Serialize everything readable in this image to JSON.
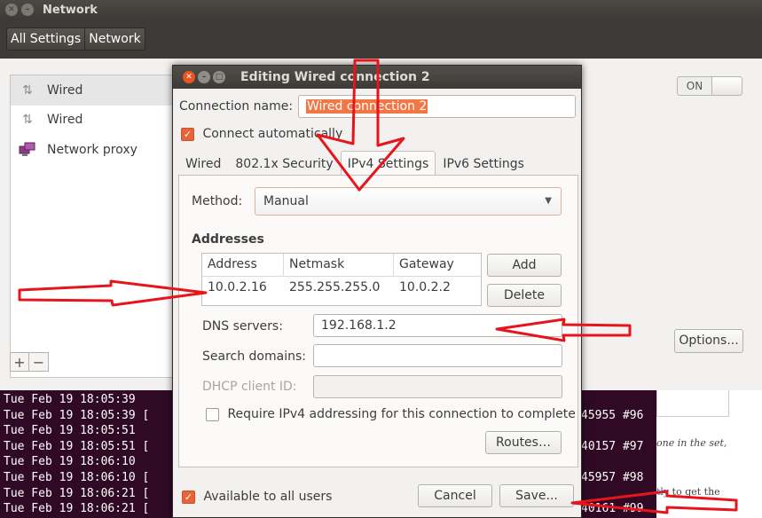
{
  "network_window": {
    "title": "Network",
    "toolbar": {
      "all_settings": "All Settings",
      "network": "Network"
    },
    "sidebar": [
      {
        "label": "Wired",
        "icon": "wired-icon"
      },
      {
        "label": "Wired",
        "icon": "wired-icon"
      },
      {
        "label": "Network proxy",
        "icon": "network-proxy-icon"
      }
    ],
    "switch_label": "ON",
    "add_symbol": "+",
    "remove_symbol": "−",
    "options_label": "Options..."
  },
  "dialog": {
    "title": "Editing Wired connection 2",
    "connection_name_label": "Connection name:",
    "connection_name_value": "Wired connection 2",
    "connect_auto_label": "Connect automatically",
    "connect_auto_checked": true,
    "tabs": [
      "Wired",
      "802.1x Security",
      "IPv4 Settings",
      "IPv6 Settings"
    ],
    "active_tab": "IPv4 Settings",
    "method_label": "Method:",
    "method_value": "Manual",
    "addresses_label": "Addresses",
    "addr_columns": [
      "Address",
      "Netmask",
      "Gateway"
    ],
    "addr_rows": [
      {
        "address": "10.0.2.16",
        "netmask": "255.255.255.0",
        "gateway": "10.0.2.2"
      }
    ],
    "add_label": "Add",
    "delete_label": "Delete",
    "dns_label": "DNS servers:",
    "dns_value": "192.168.1.2",
    "search_label": "Search domains:",
    "search_value": "",
    "dhcp_label": "DHCP client ID:",
    "dhcp_value": "",
    "require_ipv4_label": "Require IPv4 addressing for this connection to complete",
    "require_ipv4_checked": false,
    "routes_label": "Routes…",
    "available_label": "Available to all users",
    "available_checked": true,
    "cancel_label": "Cancel",
    "save_label": "Save..."
  },
  "terminal": {
    "lines": [
      {
        "time": "Tue Feb 19 18:05:39",
        "tail": ""
      },
      {
        "time": "Tue Feb 19 18:05:39 [",
        "tail": "45955 #96"
      },
      {
        "time": "Tue Feb 19 18:05:51",
        "tail": ""
      },
      {
        "time": "Tue Feb 19 18:05:51 [",
        "tail": "40157 #97"
      },
      {
        "time": "Tue Feb 19 18:06:10",
        "tail": ""
      },
      {
        "time": "Tue Feb 19 18:06:10 [",
        "tail": "45957 #98"
      },
      {
        "time": "Tue Feb 19 18:06:21 [",
        "tail": ""
      },
      {
        "time": "Tue Feb 19 18:06:21 [",
        "tail": "40161 #99"
      }
    ]
  },
  "webpage": {
    "snippet1": "one in the set,",
    "snippet2_link": "tly",
    "snippet2_rest": " to get the"
  },
  "colors": {
    "accent": "#e95420",
    "annotation": "#e8141c",
    "terminal_bg": "#300a24"
  }
}
